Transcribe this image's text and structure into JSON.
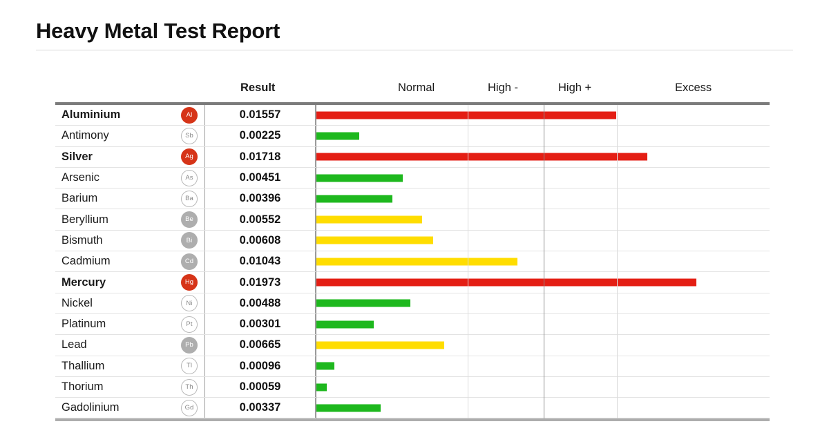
{
  "report": {
    "title": "Heavy Metal Test Report"
  },
  "table": {
    "columns": {
      "element": "",
      "symbol": "",
      "result": "Result"
    },
    "scale_headers": [
      "Normal",
      "High -",
      "High +",
      "Excess"
    ]
  },
  "colors": {
    "bar_normal": "#1eb81e",
    "bar_high": "#ffdd00",
    "bar_excess": "#e41e14",
    "badge_plain_border": "#b9b9b9",
    "badge_plain_text": "#8a8a8a",
    "badge_gray": "#aeaeae",
    "badge_red": "#d63418",
    "table_top_border": "#7b7b7b",
    "table_bottom_border": "#adadad",
    "gridline_light": "#dcdcdc",
    "gridline_dark": "#8c8c8c"
  },
  "chart_data": {
    "type": "bar",
    "title": "Heavy Metal Test Report",
    "orientation": "horizontal",
    "xlabel": "",
    "ylabel": "",
    "xlim": [
      0,
      0.0235
    ],
    "grid": true,
    "legend_position": "top",
    "categories": [
      "Aluminium",
      "Antimony",
      "Silver",
      "Arsenic",
      "Barium",
      "Beryllium",
      "Bismuth",
      "Cadmium",
      "Mercury",
      "Nickel",
      "Platinum",
      "Lead",
      "Thallium",
      "Thorium",
      "Gadolinium"
    ],
    "values": [
      0.01557,
      0.00225,
      0.01718,
      0.00451,
      0.00396,
      0.00552,
      0.00608,
      0.01043,
      0.01973,
      0.00488,
      0.00301,
      0.00665,
      0.00096,
      0.00059,
      0.00337
    ],
    "value_labels": [
      "0.01557",
      "0.00225",
      "0.01718",
      "0.00451",
      "0.00396",
      "0.00552",
      "0.00608",
      "0.01043",
      "0.01973",
      "0.00488",
      "0.00301",
      "0.00665",
      "0.00096",
      "0.00059",
      "0.00337"
    ],
    "symbols": [
      "Al",
      "Sb",
      "Ag",
      "As",
      "Ba",
      "Be",
      "Bi",
      "Cd",
      "Hg",
      "Ni",
      "Pt",
      "Pb",
      "Tl",
      "Th",
      "Gd"
    ],
    "statuses": [
      "excess",
      "normal",
      "excess",
      "normal",
      "normal",
      "high",
      "high",
      "high",
      "excess",
      "normal",
      "normal",
      "high",
      "normal",
      "normal",
      "normal"
    ],
    "zone_labels": [
      "Normal",
      "High -",
      "High +",
      "Excess"
    ],
    "zone_boundaries": [
      0.005,
      0.0075,
      0.0099
    ]
  },
  "rows": [
    {
      "name": "Aluminium",
      "symbol": "Al",
      "result": "0.01557",
      "status": "excess",
      "badge": "red",
      "pct": 66.2
    },
    {
      "name": "Antimony",
      "symbol": "Sb",
      "result": "0.00225",
      "status": "normal",
      "badge": "plain",
      "pct": 9.6
    },
    {
      "name": "Silver",
      "symbol": "Ag",
      "result": "0.01718",
      "status": "excess",
      "badge": "red",
      "pct": 73.1
    },
    {
      "name": "Arsenic",
      "symbol": "As",
      "result": "0.00451",
      "status": "normal",
      "badge": "plain",
      "pct": 19.2
    },
    {
      "name": "Barium",
      "symbol": "Ba",
      "result": "0.00396",
      "status": "normal",
      "badge": "plain",
      "pct": 16.9
    },
    {
      "name": "Beryllium",
      "symbol": "Be",
      "result": "0.00552",
      "status": "high",
      "badge": "gray",
      "pct": 23.5
    },
    {
      "name": "Bismuth",
      "symbol": "Bi",
      "result": "0.00608",
      "status": "high",
      "badge": "gray",
      "pct": 25.9
    },
    {
      "name": "Cadmium",
      "symbol": "Cd",
      "result": "0.01043",
      "status": "high",
      "badge": "gray",
      "pct": 44.4
    },
    {
      "name": "Mercury",
      "symbol": "Hg",
      "result": "0.01973",
      "status": "excess",
      "badge": "red",
      "pct": 83.9
    },
    {
      "name": "Nickel",
      "symbol": "Ni",
      "result": "0.00488",
      "status": "normal",
      "badge": "plain",
      "pct": 20.8
    },
    {
      "name": "Platinum",
      "symbol": "Pt",
      "result": "0.00301",
      "status": "normal",
      "badge": "plain",
      "pct": 12.8
    },
    {
      "name": "Lead",
      "symbol": "Pb",
      "result": "0.00665",
      "status": "high",
      "badge": "gray",
      "pct": 28.3
    },
    {
      "name": "Thallium",
      "symbol": "Tl",
      "result": "0.00096",
      "status": "normal",
      "badge": "plain",
      "pct": 4.1
    },
    {
      "name": "Thorium",
      "symbol": "Th",
      "result": "0.00059",
      "status": "normal",
      "badge": "plain",
      "pct": 2.5
    },
    {
      "name": "Gadolinium",
      "symbol": "Gd",
      "result": "0.00337",
      "status": "normal",
      "badge": "plain",
      "pct": 14.3
    }
  ],
  "layout": {
    "header_positions": [
      270,
      460,
      620,
      740,
      890
    ],
    "gridline_positions": [
      0,
      220,
      330,
      436
    ],
    "gridline_kinds": [
      "edge",
      "light",
      "dark",
      "light"
    ]
  }
}
